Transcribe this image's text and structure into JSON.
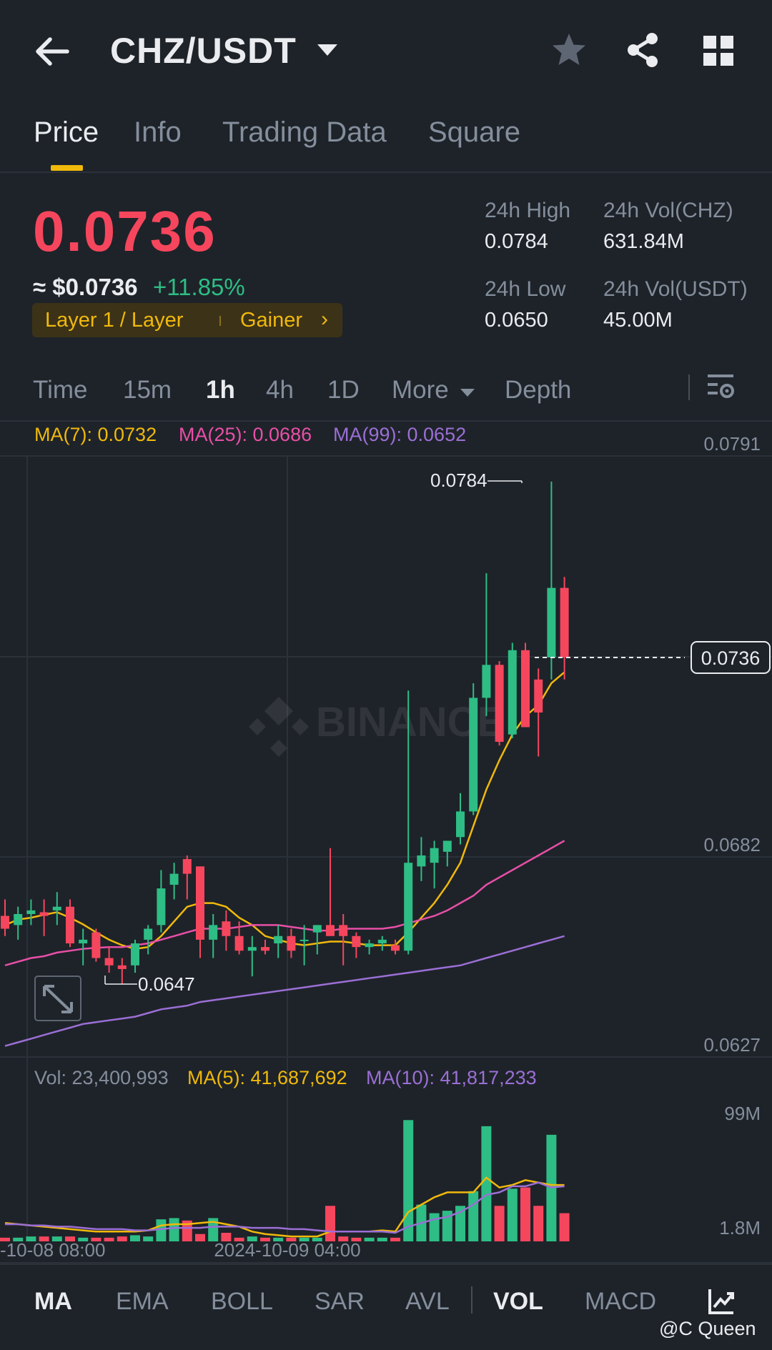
{
  "header": {
    "pair": "CHZ/USDT",
    "back_icon": "arrow-left-icon",
    "star_icon": "star-icon",
    "share_icon": "share-icon",
    "grid_icon": "grid-icon"
  },
  "tabs": [
    {
      "label": "Price",
      "active": true
    },
    {
      "label": "Info",
      "active": false
    },
    {
      "label": "Trading Data",
      "active": false
    },
    {
      "label": "Square",
      "active": false
    }
  ],
  "ticker": {
    "price": "0.0736",
    "approx": "≈ $0.0736",
    "change": "+11.85%",
    "tag_category": "Layer 1 / Layer",
    "tag_rank": "Gainer",
    "stats": {
      "high_label": "24h High",
      "high_value": "0.0784",
      "low_label": "24h Low",
      "low_value": "0.0650",
      "vol_base_label": "24h Vol(CHZ)",
      "vol_base_value": "631.84M",
      "vol_quote_label": "24h Vol(USDT)",
      "vol_quote_value": "45.00M"
    }
  },
  "intervals": {
    "time": "Time",
    "m15": "15m",
    "h1": "1h",
    "h4": "4h",
    "d1": "1D",
    "more": "More",
    "depth": "Depth",
    "active": "1h"
  },
  "ma_legend": {
    "ma7": "MA(7): 0.0732",
    "ma25": "MA(25): 0.0686",
    "ma99": "MA(99): 0.0652"
  },
  "vol_legend": {
    "vol": "Vol: 23,400,993",
    "ma5": "MA(5): 41,687,692",
    "ma10": "MA(10): 41,817,233"
  },
  "price_axis": {
    "top": "0.0791",
    "current": "0.0736",
    "mid": "0.0682",
    "bottom": "0.0627",
    "high_marker": "0.0784",
    "low_marker": "0.0647"
  },
  "volume_axis": {
    "top": "99M",
    "bottom": "1.8M"
  },
  "time_axis": {
    "t1": "-10-08 08:00",
    "t2": "2024-10-09 04:00"
  },
  "indicators": [
    {
      "label": "MA",
      "active": true
    },
    {
      "label": "EMA",
      "active": false
    },
    {
      "label": "BOLL",
      "active": false
    },
    {
      "label": "SAR",
      "active": false
    },
    {
      "label": "AVL",
      "active": false
    },
    {
      "label": "VOL",
      "active": true
    },
    {
      "label": "MACD",
      "active": false
    }
  ],
  "watermark": {
    "brand": "BINANCE",
    "credit": "@C Queen"
  },
  "colors": {
    "up": "#2ebd85",
    "down": "#f6465d",
    "accent": "#f0b90b",
    "ma7": "#f0b90b",
    "ma25": "#e84fa7",
    "ma99": "#9b6fd6",
    "bg": "#1e2329"
  },
  "chart_data": {
    "type": "candlestick",
    "ylim": [
      0.0627,
      0.0791
    ],
    "candles": [
      {
        "o": 0.06655,
        "h": 0.067,
        "l": 0.066,
        "c": 0.0662
      },
      {
        "o": 0.0663,
        "h": 0.0668,
        "l": 0.0659,
        "c": 0.0666
      },
      {
        "o": 0.0666,
        "h": 0.067,
        "l": 0.0663,
        "c": 0.0667
      },
      {
        "o": 0.06665,
        "h": 0.067,
        "l": 0.066,
        "c": 0.06655
      },
      {
        "o": 0.0667,
        "h": 0.0672,
        "l": 0.0663,
        "c": 0.0668
      },
      {
        "o": 0.0668,
        "h": 0.067,
        "l": 0.0657,
        "c": 0.0658
      },
      {
        "o": 0.0658,
        "h": 0.0662,
        "l": 0.0652,
        "c": 0.0659
      },
      {
        "o": 0.0661,
        "h": 0.0662,
        "l": 0.0653,
        "c": 0.0654
      },
      {
        "o": 0.0654,
        "h": 0.0657,
        "l": 0.065,
        "c": 0.0652
      },
      {
        "o": 0.0652,
        "h": 0.0654,
        "l": 0.0647,
        "c": 0.0651
      },
      {
        "o": 0.0652,
        "h": 0.0659,
        "l": 0.065,
        "c": 0.0658
      },
      {
        "o": 0.0659,
        "h": 0.0663,
        "l": 0.0655,
        "c": 0.0662
      },
      {
        "o": 0.0663,
        "h": 0.0678,
        "l": 0.0661,
        "c": 0.0673
      },
      {
        "o": 0.0674,
        "h": 0.068,
        "l": 0.067,
        "c": 0.0677
      },
      {
        "o": 0.0681,
        "h": 0.0682,
        "l": 0.067,
        "c": 0.0677
      },
      {
        "o": 0.0679,
        "h": 0.0679,
        "l": 0.0654,
        "c": 0.0659
      },
      {
        "o": 0.0659,
        "h": 0.0666,
        "l": 0.0654,
        "c": 0.0663
      },
      {
        "o": 0.0664,
        "h": 0.0667,
        "l": 0.0656,
        "c": 0.066
      },
      {
        "o": 0.066,
        "h": 0.0664,
        "l": 0.0655,
        "c": 0.0656
      },
      {
        "o": 0.0656,
        "h": 0.066,
        "l": 0.0649,
        "c": 0.0657
      },
      {
        "o": 0.0657,
        "h": 0.0659,
        "l": 0.0655,
        "c": 0.0656
      },
      {
        "o": 0.0658,
        "h": 0.0663,
        "l": 0.0654,
        "c": 0.066
      },
      {
        "o": 0.066,
        "h": 0.0662,
        "l": 0.0654,
        "c": 0.0656
      },
      {
        "o": 0.0659,
        "h": 0.0663,
        "l": 0.0652,
        "c": 0.0659
      },
      {
        "o": 0.0661,
        "h": 0.0663,
        "l": 0.0655,
        "c": 0.0663
      },
      {
        "o": 0.0663,
        "h": 0.0684,
        "l": 0.066,
        "c": 0.066
      },
      {
        "o": 0.0663,
        "h": 0.0666,
        "l": 0.0652,
        "c": 0.066
      },
      {
        "o": 0.066,
        "h": 0.0661,
        "l": 0.0654,
        "c": 0.0657
      },
      {
        "o": 0.0657,
        "h": 0.0659,
        "l": 0.0655,
        "c": 0.0658
      },
      {
        "o": 0.0658,
        "h": 0.066,
        "l": 0.0656,
        "c": 0.0659
      },
      {
        "o": 0.06575,
        "h": 0.0659,
        "l": 0.0655,
        "c": 0.0656
      },
      {
        "o": 0.0656,
        "h": 0.0727,
        "l": 0.0655,
        "c": 0.068
      },
      {
        "o": 0.0679,
        "h": 0.0687,
        "l": 0.0675,
        "c": 0.0682
      },
      {
        "o": 0.068,
        "h": 0.0686,
        "l": 0.0673,
        "c": 0.0684
      },
      {
        "o": 0.0683,
        "h": 0.0686,
        "l": 0.0679,
        "c": 0.0686
      },
      {
        "o": 0.0687,
        "h": 0.0699,
        "l": 0.0685,
        "c": 0.0694
      },
      {
        "o": 0.0694,
        "h": 0.0729,
        "l": 0.0693,
        "c": 0.0725
      },
      {
        "o": 0.0725,
        "h": 0.0759,
        "l": 0.072,
        "c": 0.0734
      },
      {
        "o": 0.0734,
        "h": 0.0735,
        "l": 0.0712,
        "c": 0.0713
      },
      {
        "o": 0.0715,
        "h": 0.074,
        "l": 0.0714,
        "c": 0.0738
      },
      {
        "o": 0.0738,
        "h": 0.074,
        "l": 0.0718,
        "c": 0.0717
      },
      {
        "o": 0.073,
        "h": 0.0733,
        "l": 0.0709,
        "c": 0.0721
      },
      {
        "o": 0.0736,
        "h": 0.0784,
        "l": 0.073,
        "c": 0.0755
      },
      {
        "o": 0.0755,
        "h": 0.0758,
        "l": 0.073,
        "c": 0.0736
      }
    ],
    "ma7": [
      0.0663,
      0.06645,
      0.0665,
      0.06658,
      0.06665,
      0.0665,
      0.06632,
      0.0661,
      0.0659,
      0.06575,
      0.06565,
      0.0657,
      0.066,
      0.0664,
      0.0668,
      0.0669,
      0.0669,
      0.0668,
      0.0665,
      0.0663,
      0.066,
      0.0659,
      0.0658,
      0.06575,
      0.0658,
      0.06585,
      0.06585,
      0.0658,
      0.06575,
      0.06575,
      0.06575,
      0.0661,
      0.0665,
      0.0669,
      0.0674,
      0.068,
      0.069,
      0.07,
      0.0708,
      0.0715,
      0.072,
      0.0723,
      0.0729,
      0.0732
    ],
    "ma25": [
      0.0652,
      0.0653,
      0.0654,
      0.06545,
      0.06555,
      0.0656,
      0.06565,
      0.06568,
      0.0657,
      0.0657,
      0.06575,
      0.0658,
      0.0659,
      0.066,
      0.0661,
      0.0662,
      0.0662,
      0.0662,
      0.06625,
      0.0663,
      0.0663,
      0.0663,
      0.06625,
      0.0662,
      0.06615,
      0.06615,
      0.0662,
      0.0662,
      0.0662,
      0.0662,
      0.06625,
      0.06635,
      0.06645,
      0.06655,
      0.0667,
      0.0669,
      0.0671,
      0.0674,
      0.0676,
      0.0678,
      0.068,
      0.0682,
      0.0684,
      0.0686
    ],
    "ma99": [
      0.063,
      0.0631,
      0.0632,
      0.0633,
      0.0634,
      0.0635,
      0.0636,
      0.06365,
      0.0637,
      0.06375,
      0.0638,
      0.0639,
      0.064,
      0.06405,
      0.0641,
      0.0642,
      0.06425,
      0.0643,
      0.06435,
      0.0644,
      0.06445,
      0.0645,
      0.06455,
      0.0646,
      0.06465,
      0.0647,
      0.06475,
      0.0648,
      0.06485,
      0.0649,
      0.06495,
      0.065,
      0.06505,
      0.0651,
      0.06515,
      0.0652,
      0.0653,
      0.0654,
      0.0655,
      0.0656,
      0.0657,
      0.0658,
      0.0659,
      0.066
    ],
    "volume": {
      "ylim": [
        0,
        112
      ],
      "values": [
        3,
        3,
        4,
        4,
        4,
        4,
        3,
        3,
        3,
        4,
        5,
        4,
        18,
        19,
        17,
        6,
        19,
        7,
        3,
        4,
        3,
        3,
        3,
        3,
        3,
        29,
        4,
        3,
        3,
        3,
        3,
        99,
        30,
        23,
        25,
        29,
        41,
        94,
        29,
        43,
        44,
        29,
        87,
        23
      ],
      "ma5": [
        15,
        14,
        13,
        12,
        11,
        10,
        9,
        8,
        8,
        8,
        8,
        9,
        13,
        14,
        14,
        15,
        16,
        14,
        12,
        8,
        6,
        5,
        4,
        4,
        4,
        8,
        8,
        8,
        8,
        9,
        8,
        24,
        30,
        36,
        40,
        40,
        40,
        52,
        44,
        46,
        50,
        48,
        46,
        46
      ],
      "ma10": [
        14,
        14,
        13,
        13,
        12,
        12,
        11,
        10,
        10,
        10,
        9,
        9,
        10,
        11,
        11,
        11,
        12,
        12,
        12,
        11,
        11,
        11,
        10,
        10,
        9,
        8,
        8,
        8,
        8,
        8,
        7,
        12,
        15,
        18,
        20,
        24,
        30,
        38,
        40,
        45,
        45,
        48,
        44,
        45
      ]
    }
  }
}
